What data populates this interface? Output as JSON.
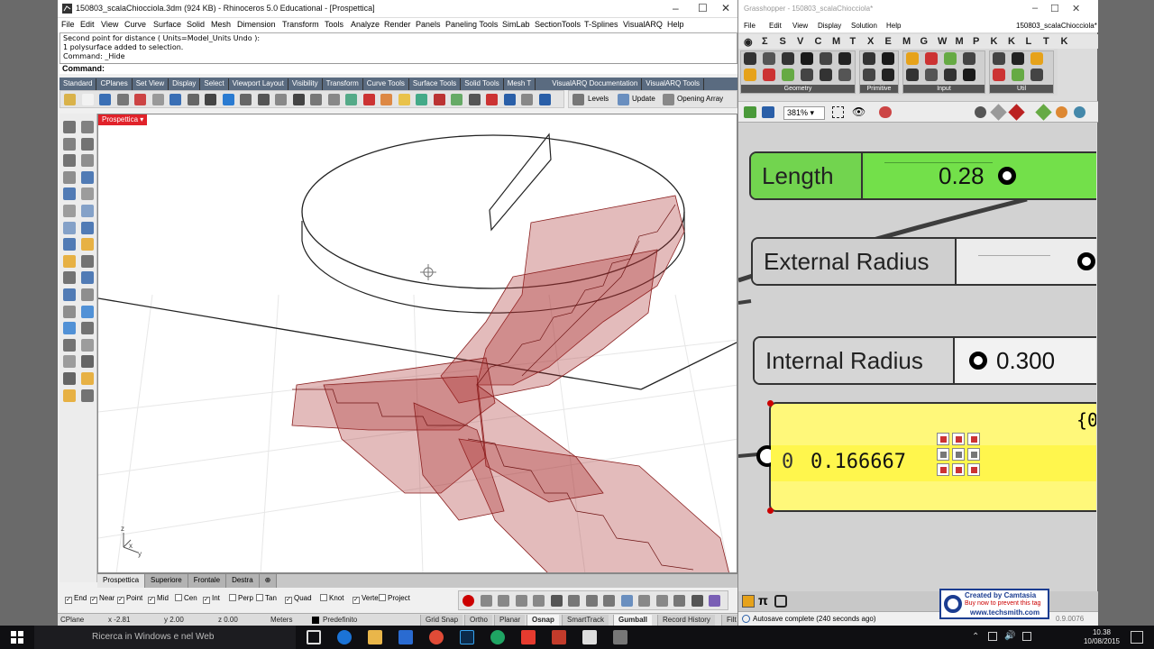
{
  "rhino": {
    "title": "150803_scalaChiocciola.3dm (924 KB) - Rhinoceros 5.0 Educational - [Prospettica]",
    "menu": [
      "File",
      "Edit",
      "View",
      "Curve",
      "Surface",
      "Solid",
      "Mesh",
      "Dimension",
      "Transform",
      "Tools",
      "Analyze",
      "Render",
      "Panels",
      "Paneling Tools",
      "SimLab",
      "SectionTools",
      "T-Splines",
      "VisualARQ",
      "Help"
    ],
    "command_history": [
      "Second point for distance ( Units=Model_Units  Undo ):",
      "1 polysurface added to selection.",
      "Command: _Hide"
    ],
    "command_prompt": "Command:",
    "toolbar_tabs": [
      "Standard",
      "CPlanes",
      "Set View",
      "Display",
      "Select",
      "Viewport Layout",
      "Visibility",
      "Transform",
      "Curve Tools",
      "Surface Tools",
      "Solid Tools",
      "Mesh T"
    ],
    "varq_tabs": [
      "VisualARQ Documentation",
      "VisualARQ Tools"
    ],
    "varq_buttons": {
      "levels": "Levels",
      "update": "Update",
      "opening": "Opening Array"
    },
    "viewport_label": "Prospettica",
    "axis": {
      "x": "x",
      "y": "y",
      "z": "z"
    },
    "viewport_tabs": [
      "Prospettica",
      "Superiore",
      "Frontale",
      "Destra"
    ],
    "osnaps": [
      {
        "label": "End",
        "checked": true
      },
      {
        "label": "Near",
        "checked": true
      },
      {
        "label": "Point",
        "checked": true
      },
      {
        "label": "Mid",
        "checked": true
      },
      {
        "label": "Cen",
        "checked": false
      },
      {
        "label": "Int",
        "checked": true
      },
      {
        "label": "Perp",
        "checked": false
      },
      {
        "label": "Tan",
        "checked": false
      },
      {
        "label": "Quad",
        "checked": true
      },
      {
        "label": "Knot",
        "checked": false
      },
      {
        "label": "Vertex",
        "checked": true
      },
      {
        "label": "Project",
        "checked": false
      }
    ],
    "status": {
      "cplane": "CPlane",
      "x": "x -2.81",
      "y": "y 2.00",
      "z": "z 0.00",
      "units": "Meters",
      "layer": "Predefinito",
      "grid_snap": "Grid Snap",
      "ortho": "Ortho",
      "planar": "Planar",
      "osnap": "Osnap",
      "smarttrack": "SmartTrack",
      "gumball": "Gumball",
      "record_history": "Record History",
      "filter": "Filt"
    }
  },
  "grasshopper": {
    "title": "Grasshopper - 150803_scalaChiocciola*",
    "menu": [
      "File",
      "Edit",
      "View",
      "Display",
      "Solution",
      "Help"
    ],
    "doc_name": "150803_scalaChiocciola*",
    "tabs": [
      "Σ",
      "S",
      "V",
      "C",
      "M",
      "T",
      "X",
      "E",
      "M",
      "G",
      "W",
      "M",
      "P",
      "K",
      "K",
      "L",
      "T",
      "K"
    ],
    "groups": [
      "Geometry",
      "Primitive",
      "Input",
      "Util"
    ],
    "zoom": "381%",
    "sliders": [
      {
        "name": "Length",
        "value": "0.28"
      },
      {
        "name": "External Radius",
        "value": ""
      },
      {
        "name": "Internal Radius",
        "value": "0.300"
      }
    ],
    "panel": {
      "header": "{0",
      "index": "0",
      "value": "0.166667"
    },
    "status": "Autosave complete (240 seconds ago)",
    "version": "0.9.0076",
    "colors": {
      "green": "#6fd84a",
      "panel_yellow": "#fff87a"
    }
  },
  "watermark": {
    "line1": "Created by Camtasia",
    "line2": "Buy now to prevent this tag",
    "line3": "www.techsmith.com"
  },
  "taskbar": {
    "search": "Ricerca in Windows e nel Web",
    "time": "10.38",
    "date": "10/08/2015"
  }
}
